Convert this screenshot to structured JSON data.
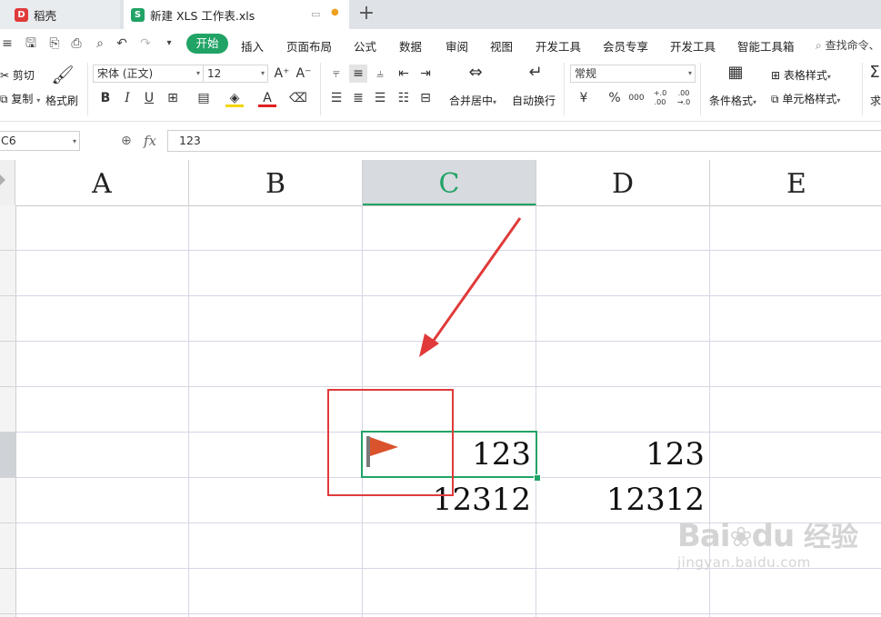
{
  "tabs": {
    "tab1": {
      "label": "稻壳",
      "logo": "daoke-logo-icon",
      "color": "#e03a3a"
    },
    "tab2": {
      "label": "新建 XLS 工作表.xls",
      "logo": "sheet-logo-icon",
      "color": "#21a366"
    }
  },
  "menu": {
    "items": [
      "开始",
      "插入",
      "页面布局",
      "公式",
      "数据",
      "审阅",
      "视图",
      "开发工具",
      "会员专享",
      "开发工具",
      "智能工具箱"
    ],
    "search": "查找命令、",
    "active_color": "#21a366"
  },
  "ribbon": {
    "cut": "剪切",
    "copy": "复制",
    "format_painter": "格式刷",
    "font_name": "宋体 (正文)",
    "font_size": "12",
    "bold": "B",
    "italic": "I",
    "underline": "U",
    "merge_center": "合并居中",
    "wrap_text": "自动换行",
    "number_format": "常规",
    "currency": "¥",
    "percent": "%",
    "thousands": "000",
    "inc_decimal": "+.0 .00",
    "dec_decimal": ".00 →.0",
    "cond_format": "条件格式",
    "table_style": "表格样式",
    "cell_style": "单元格样式",
    "sum": "求"
  },
  "formula_bar": {
    "name_box": "C6",
    "fx": "fx",
    "value": "123"
  },
  "grid": {
    "columns": [
      "A",
      "B",
      "C",
      "D",
      "E"
    ],
    "active_column": "C",
    "active_cell": "C6",
    "cells": {
      "C6": "123",
      "D6": "123",
      "C7": "12312",
      "D7": "12312"
    },
    "accent_color": "#21a366",
    "annotation_color": "#e03a3a"
  },
  "watermark": {
    "brand": "Bai",
    "brand2": "du",
    "jingyan": "经验",
    "url": "jingyan.baidu.com"
  }
}
